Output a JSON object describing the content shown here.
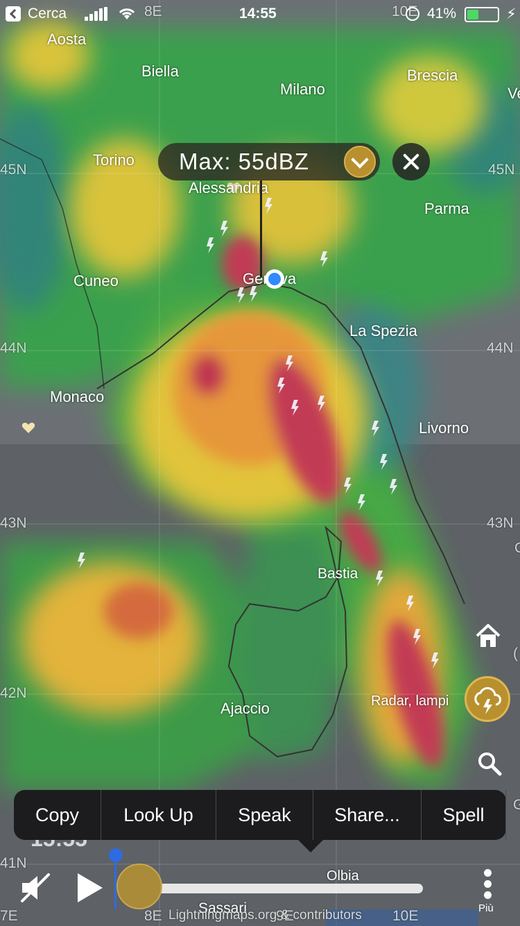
{
  "status_bar": {
    "back_label": "Cerca",
    "time": "14:55",
    "battery_percent": "41%",
    "battery_level": 0.41,
    "icons": [
      "signal-icon",
      "wifi-icon",
      "alarm-icon",
      "battery-icon",
      "charging-icon"
    ]
  },
  "map": {
    "cities": [
      "Aosta",
      "Biella",
      "Milano",
      "Brescia",
      "Ve",
      "Torino",
      "Alessandria",
      "Parma",
      "Cuneo",
      "Genova",
      "La Spezia",
      "Monaco",
      "Livorno",
      "Bastia",
      "Ajaccio",
      "Olbia",
      "Sassari"
    ],
    "lat_labels": [
      "45N",
      "45N",
      "44N",
      "44N",
      "43N",
      "43N",
      "42N",
      "41N"
    ],
    "lon_labels": [
      "8E",
      "10E",
      "7E",
      "8E",
      "9E",
      "10E"
    ],
    "extra_labels": [
      "C",
      "(",
      "G"
    ],
    "attribution": "Lightningmaps.org & contributors"
  },
  "readout": {
    "max_label": "Max: 55dBZ"
  },
  "controls": {
    "layer_label": "Radar, lampi",
    "more_label": "Più",
    "timeline_behind_text": "15:55"
  },
  "context_menu": {
    "items": [
      "Copy",
      "Look Up",
      "Speak",
      "Share...",
      "Spell"
    ]
  },
  "colors": {
    "accent_gold": "#b8902e",
    "location_blue": "#2f8bff",
    "timeline_blue": "#2f6be0"
  }
}
